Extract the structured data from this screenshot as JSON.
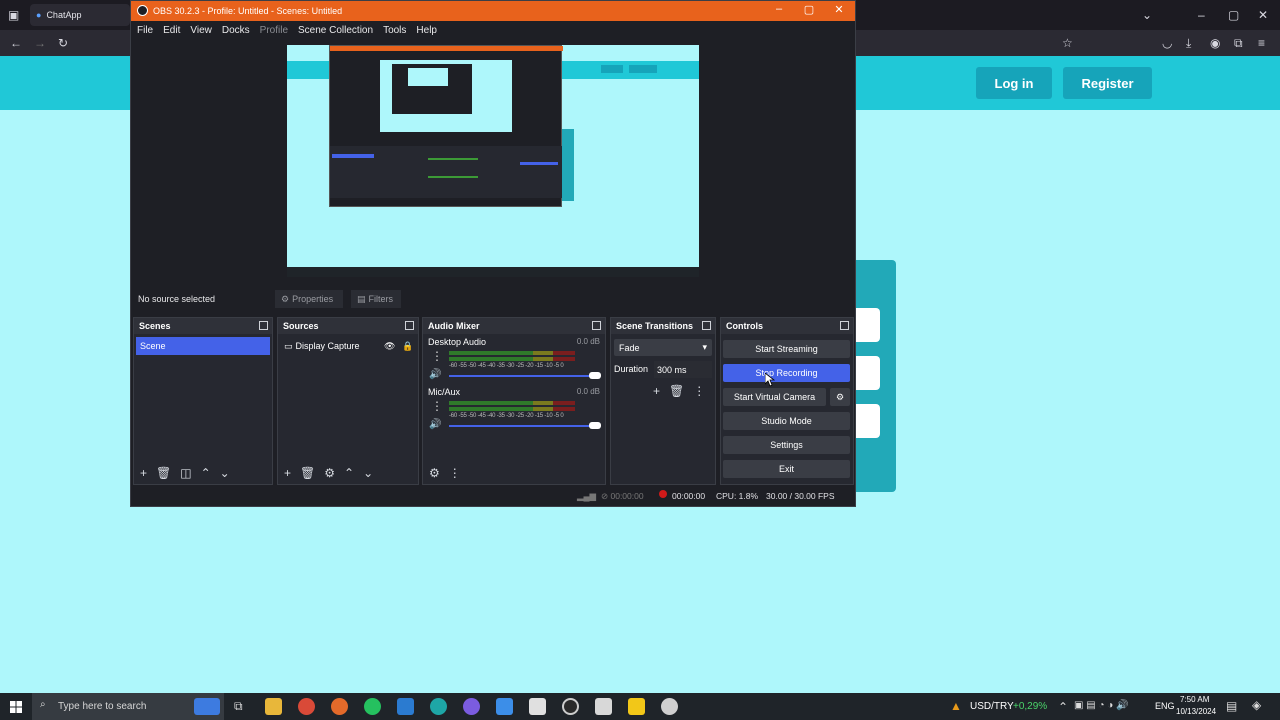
{
  "browser": {
    "tab_label": "ChatApp",
    "site": {
      "login_label": "Log in",
      "register_label": "Register"
    }
  },
  "obs": {
    "title": "OBS 30.2.3 - Profile: Untitled - Scenes: Untitled",
    "menu": [
      "File",
      "Edit",
      "View",
      "Docks",
      "Profile",
      "Scene Collection",
      "Tools",
      "Help"
    ],
    "context_bar": {
      "no_source": "No source selected",
      "properties": "Properties",
      "filters": "Filters"
    },
    "scenes": {
      "title": "Scenes",
      "items": [
        "Scene"
      ]
    },
    "sources": {
      "title": "Sources",
      "items": [
        "Display Capture"
      ]
    },
    "audio_mixer": {
      "title": "Audio Mixer",
      "channels": [
        {
          "name": "Desktop Audio",
          "db": "0.0 dB"
        },
        {
          "name": "Mic/Aux",
          "db": "0.0 dB"
        }
      ],
      "scale": "-60 -55 -50 -45 -40 -35 -30 -25 -20 -15 -10 -5 0"
    },
    "transitions": {
      "title": "Scene Transitions",
      "selected": "Fade",
      "duration_label": "Duration",
      "duration_value": "300 ms"
    },
    "controls": {
      "title": "Controls",
      "start_streaming": "Start Streaming",
      "stop_recording": "Stop Recording",
      "start_virtual_camera": "Start Virtual Camera",
      "studio_mode": "Studio Mode",
      "settings": "Settings",
      "exit": "Exit"
    },
    "status": {
      "stream_time": "00:00:00",
      "rec_time": "00:00:00",
      "cpu": "CPU: 1.8%",
      "fps": "30.00 / 30.00 FPS"
    }
  },
  "taskbar": {
    "search_placeholder": "Type here to search",
    "ticker": "USD/TRY",
    "ticker_change": "+0,29%",
    "lang": "ENG",
    "time": "7:50 AM",
    "date": "10/13/2024"
  },
  "colors": {
    "obs_title": "#e8621c",
    "accent": "#4462e8",
    "site_teal": "#20c8d7",
    "page_bg": "#aef7fb"
  }
}
